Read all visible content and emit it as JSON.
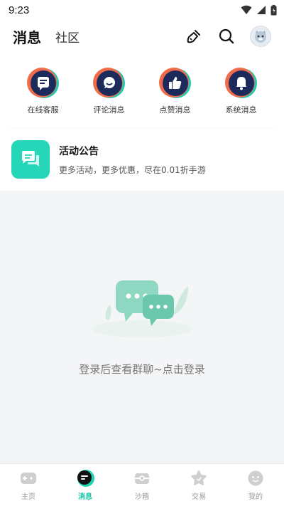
{
  "status_bar": {
    "time": "9:23"
  },
  "header": {
    "tab_active": "消息",
    "tab_inactive": "社区"
  },
  "quick_entries": [
    {
      "label": "在线客服",
      "icon": "customer-service-icon"
    },
    {
      "label": "评论消息",
      "icon": "comment-icon"
    },
    {
      "label": "点赞消息",
      "icon": "thumbs-up-icon"
    },
    {
      "label": "系统消息",
      "icon": "bell-icon"
    }
  ],
  "announcement": {
    "title": "活动公告",
    "subtitle": "更多活动，更多优惠，尽在0.01折手游"
  },
  "empty_state": {
    "text": "登录后查看群聊~点击登录"
  },
  "bottom_nav": [
    {
      "label": "主页",
      "icon": "gamepad-icon",
      "active": false
    },
    {
      "label": "消息",
      "icon": "message-icon",
      "active": true
    },
    {
      "label": "沙箱",
      "icon": "sandbox-icon",
      "active": false
    },
    {
      "label": "交易",
      "icon": "trade-icon",
      "active": false
    },
    {
      "label": "我的",
      "icon": "profile-icon",
      "active": false
    }
  ],
  "colors": {
    "accent": "#19c7a6",
    "announce_icon_bg": "#25d6b8",
    "quick_icon_dark": "#1d2b5c"
  }
}
